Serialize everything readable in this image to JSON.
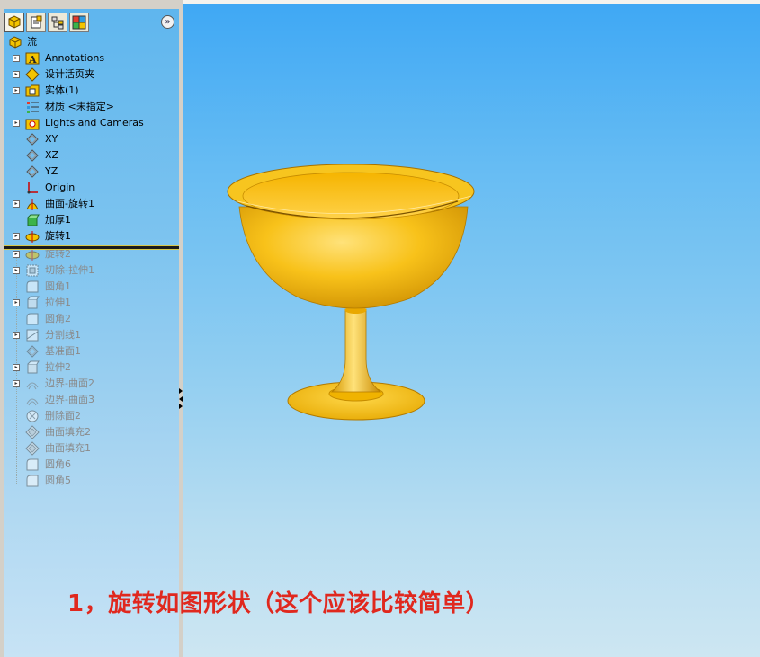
{
  "feature_tree": {
    "root": "流",
    "items": [
      {
        "label": "Annotations",
        "icon": "annotations-icon",
        "expandable": true,
        "suppressed": false
      },
      {
        "label": "设计活页夹",
        "icon": "design-binder-icon",
        "expandable": true,
        "suppressed": false
      },
      {
        "label": "实体(1)",
        "icon": "solid-bodies-icon",
        "expandable": true,
        "suppressed": false
      },
      {
        "label": "材质 <未指定>",
        "icon": "material-icon",
        "expandable": false,
        "suppressed": false
      },
      {
        "label": "Lights and Cameras",
        "icon": "lights-cameras-icon",
        "expandable": true,
        "suppressed": false
      },
      {
        "label": "XY",
        "icon": "plane-icon",
        "expandable": false,
        "suppressed": false
      },
      {
        "label": "XZ",
        "icon": "plane-icon",
        "expandable": false,
        "suppressed": false
      },
      {
        "label": "YZ",
        "icon": "plane-icon",
        "expandable": false,
        "suppressed": false
      },
      {
        "label": "Origin",
        "icon": "origin-icon",
        "expandable": false,
        "suppressed": false
      },
      {
        "label": "曲面-旋转1",
        "icon": "surface-revolve-icon",
        "expandable": true,
        "suppressed": false
      },
      {
        "label": "加厚1",
        "icon": "thicken-icon",
        "expandable": false,
        "suppressed": false
      },
      {
        "label": "旋转1",
        "icon": "revolve-icon",
        "expandable": true,
        "suppressed": false
      },
      {
        "label": "旋转2",
        "icon": "revolve-icon",
        "expandable": true,
        "suppressed": true
      },
      {
        "label": "切除-拉伸1",
        "icon": "cut-extrude-icon",
        "expandable": true,
        "suppressed": true
      },
      {
        "label": "圆角1",
        "icon": "fillet-icon",
        "expandable": false,
        "suppressed": true
      },
      {
        "label": "拉伸1",
        "icon": "extrude-icon",
        "expandable": true,
        "suppressed": true
      },
      {
        "label": "圆角2",
        "icon": "fillet-icon",
        "expandable": false,
        "suppressed": true
      },
      {
        "label": "分割线1",
        "icon": "split-line-icon",
        "expandable": true,
        "suppressed": true
      },
      {
        "label": "基准面1",
        "icon": "plane-icon",
        "expandable": false,
        "suppressed": true
      },
      {
        "label": "拉伸2",
        "icon": "extrude-icon",
        "expandable": true,
        "suppressed": true
      },
      {
        "label": "边界-曲面2",
        "icon": "boundary-surface-icon",
        "expandable": true,
        "suppressed": true
      },
      {
        "label": "边界-曲面3",
        "icon": "boundary-surface-icon",
        "expandable": false,
        "suppressed": true
      },
      {
        "label": "删除面2",
        "icon": "delete-face-icon",
        "expandable": false,
        "suppressed": true
      },
      {
        "label": "曲面填充2",
        "icon": "surface-fill-icon",
        "expandable": false,
        "suppressed": true
      },
      {
        "label": "曲面填充1",
        "icon": "surface-fill-icon",
        "expandable": false,
        "suppressed": true
      },
      {
        "label": "圆角6",
        "icon": "fillet-icon",
        "expandable": false,
        "suppressed": true
      },
      {
        "label": "圆角5",
        "icon": "fillet-icon",
        "expandable": false,
        "suppressed": true
      }
    ]
  },
  "panel_tabs": [
    {
      "name": "feature-manager-tab",
      "icon": "feature-manager-icon"
    },
    {
      "name": "property-manager-tab",
      "icon": "property-manager-icon"
    },
    {
      "name": "configuration-manager-tab",
      "icon": "configuration-manager-icon"
    },
    {
      "name": "display-manager-tab",
      "icon": "display-manager-icon"
    }
  ],
  "collapse_glyph": "»",
  "caption": "1，旋转如图形状（这个应该比较简单）",
  "colors": {
    "caption": "#e0281e",
    "model": "#f5b800",
    "model_highlight": "#ffe27a",
    "model_shadow": "#c98a00"
  }
}
